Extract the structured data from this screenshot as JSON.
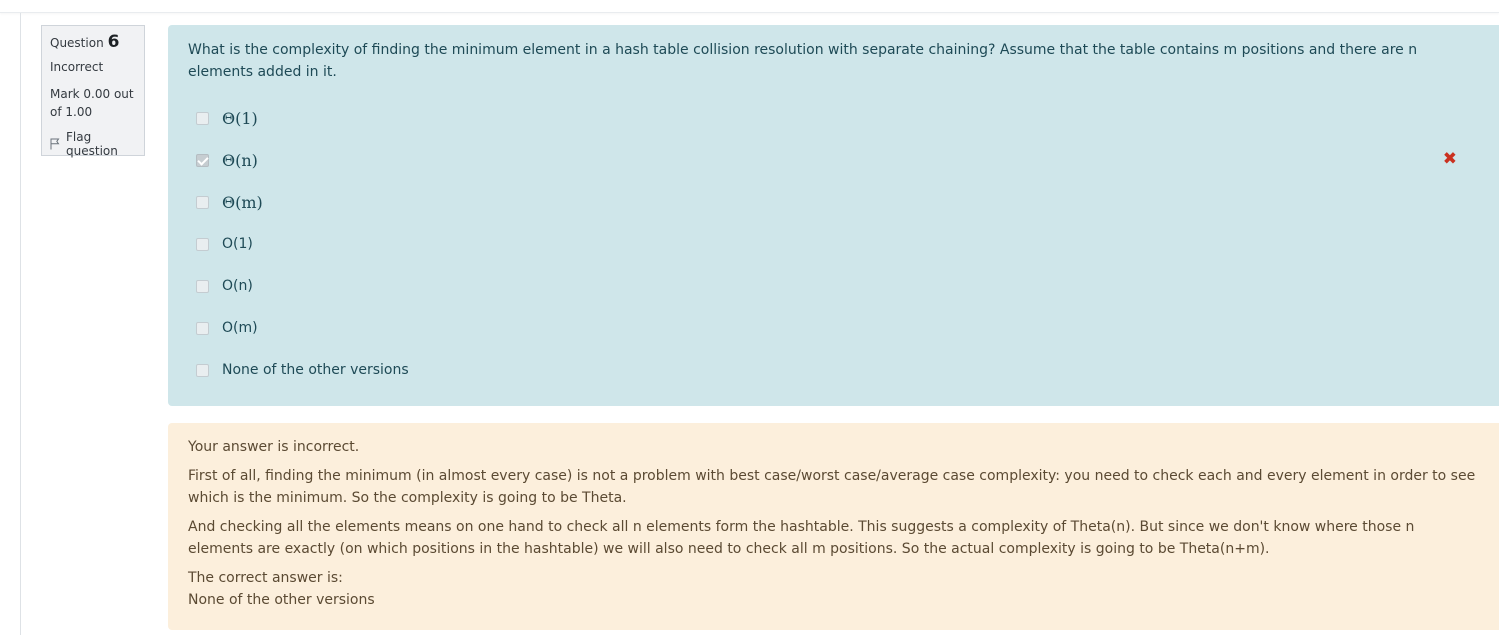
{
  "question": {
    "label": "Question",
    "number": "6",
    "state": "Incorrect",
    "grade": "Mark 0.00 out of 1.00",
    "flag_label": "Flag question",
    "text": "What is the complexity of finding the minimum element in a hash table collision resolution with separate chaining? Assume that the table contains m positions and there are n elements added in it.",
    "options": [
      {
        "label": "Θ(1)",
        "checked": false
      },
      {
        "label": "Θ(n)",
        "checked": true,
        "incorrect_mark": "✖"
      },
      {
        "label": "Θ(m)",
        "checked": false
      },
      {
        "label": "O(1)",
        "checked": false
      },
      {
        "label": "O(n)",
        "checked": false
      },
      {
        "label": "O(m)",
        "checked": false
      },
      {
        "label": "None of the other versions",
        "checked": false
      }
    ]
  },
  "feedback": {
    "result": "Your answer is incorrect.",
    "paragraph1": "First of all, finding the minimum (in almost every case) is not a problem with best case/worst case/average case complexity: you need to check each and every element in order to see which is the minimum. So the complexity is going to be Theta.",
    "paragraph2": "And checking all the elements means on one hand to check all n elements form the hashtable. This suggests a complexity of Theta(n). But since we don't know where those n elements are exactly (on which positions in the hashtable) we will also need to check all m positions. So the actual complexity is going to be Theta(n+m).",
    "correct_answer_label": "The correct answer is:",
    "correct_answer": "None of the other versions"
  },
  "colors": {
    "question_bg": "#cfe6ea",
    "feedback_bg": "#fcefdc",
    "incorrect_mark": "#ca3120"
  }
}
